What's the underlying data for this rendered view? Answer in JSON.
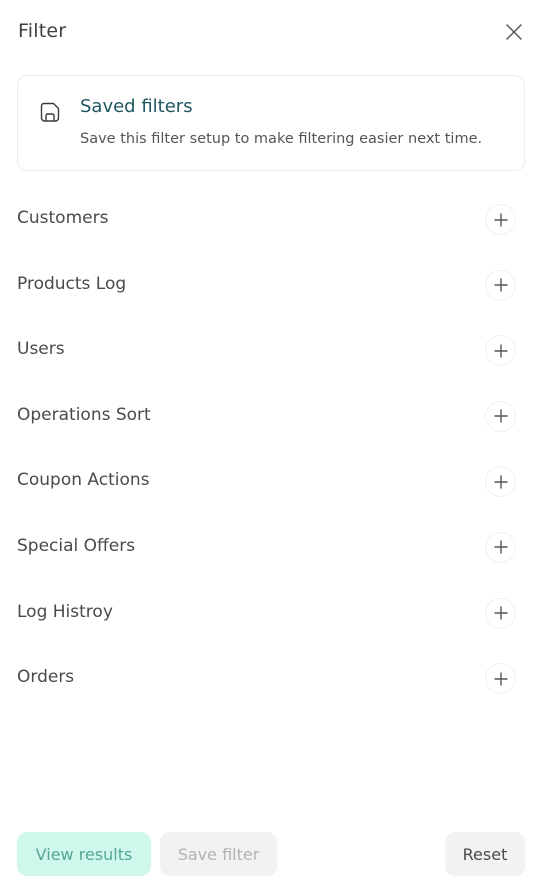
{
  "header": {
    "title": "Filter",
    "close_icon": "close-icon"
  },
  "saved_filters": {
    "title": "Saved filters",
    "description": "Save this filter setup to make filtering easier next time.",
    "icon": "floppy-save-icon"
  },
  "filters": [
    {
      "label": "Customers"
    },
    {
      "label": "Products Log"
    },
    {
      "label": "Users"
    },
    {
      "label": "Operations Sort"
    },
    {
      "label": "Coupon Actions"
    },
    {
      "label": "Special Offers"
    },
    {
      "label": "Log Histroy"
    },
    {
      "label": "Orders"
    }
  ],
  "footer": {
    "view_results": "View results",
    "save_filter": "Save filter",
    "reset": "Reset"
  },
  "colors": {
    "accent_bg": "#cff7ec",
    "accent_text": "#56a597",
    "title_teal": "#1f5560",
    "disabled_text": "#b3b3b3"
  }
}
